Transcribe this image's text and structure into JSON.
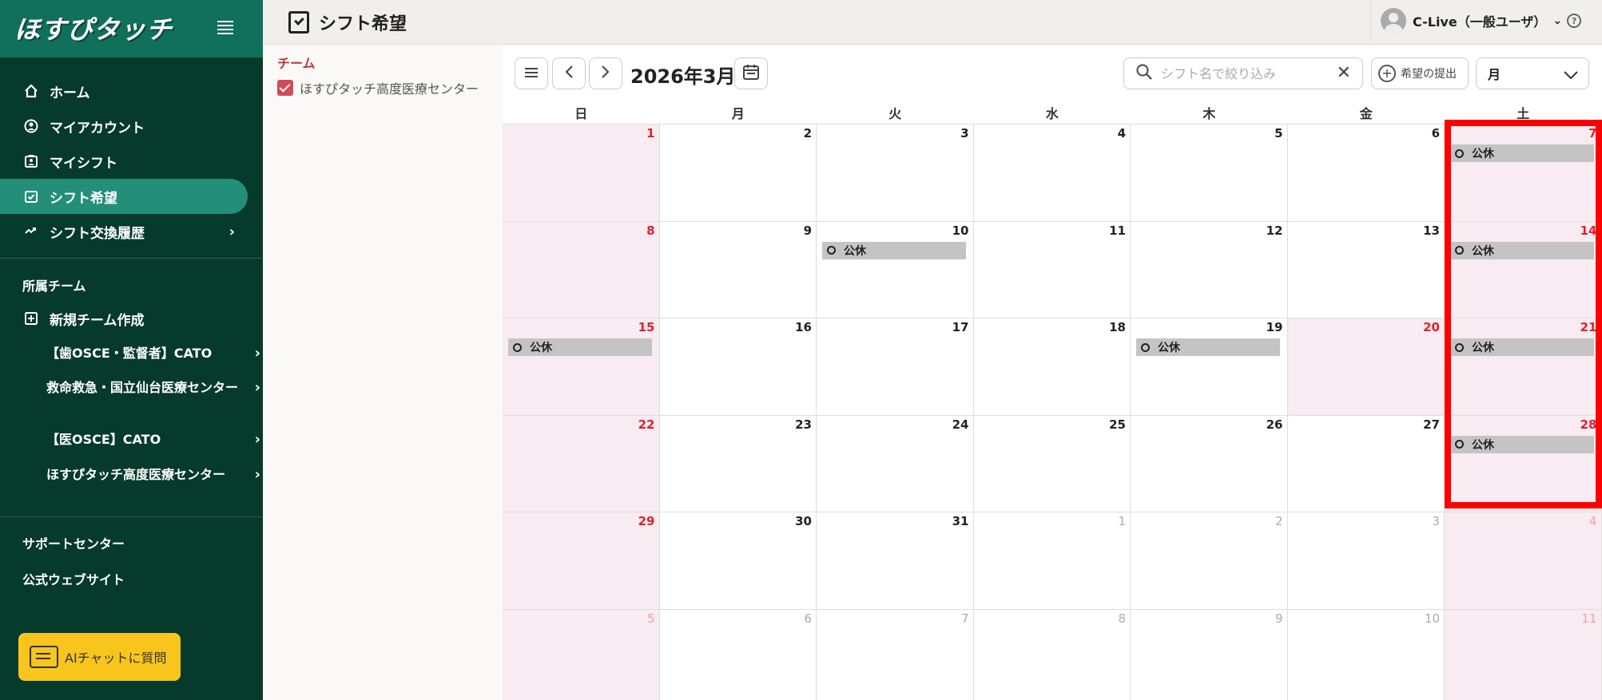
{
  "sidebar": {
    "logo": "ほすぴタッチ",
    "nav": [
      {
        "label": "ホーム",
        "icon": "home-icon"
      },
      {
        "label": "マイアカウント",
        "icon": "user-circle-icon"
      },
      {
        "label": "マイシフト",
        "icon": "badge-icon"
      },
      {
        "label": "シフト希望",
        "icon": "calendar-check-icon"
      },
      {
        "label": "シフト交換履歴",
        "icon": "swap-icon"
      }
    ],
    "team_section_label": "所属チーム",
    "new_team_label": "新規チーム作成",
    "teams": [
      {
        "label": "【歯OSCE・監督者】CATO"
      },
      {
        "label": "救命救急・国立仙台医療センター"
      },
      {
        "label": "【医OSCE】CATO"
      },
      {
        "label": "ほすぴタッチ高度医療センター"
      }
    ],
    "support_label": "サポートセンター",
    "website_label": "公式ウェブサイト",
    "ai_button_label": "AIチャットに質問"
  },
  "header": {
    "title": "シフト希望",
    "user_label": "C-Live（一般ユーザ）",
    "help_symbol": "?"
  },
  "filter": {
    "label": "チーム",
    "checkbox_label": "ほすぴタッチ高度医療センター"
  },
  "calendar": {
    "month_title": "2026年3月",
    "search_placeholder": "シフト名で絞り込み",
    "submit_label": "希望の提出",
    "view_value": "月",
    "dow": [
      "日",
      "月",
      "火",
      "水",
      "木",
      "金",
      "土"
    ],
    "weeks": [
      [
        {
          "n": "1",
          "t": "red"
        },
        {
          "n": "2"
        },
        {
          "n": "3"
        },
        {
          "n": "4"
        },
        {
          "n": "5"
        },
        {
          "n": "6"
        },
        {
          "n": "7",
          "t": "red",
          "e": "公休"
        }
      ],
      [
        {
          "n": "8",
          "t": "red"
        },
        {
          "n": "9"
        },
        {
          "n": "10",
          "e": "公休"
        },
        {
          "n": "11"
        },
        {
          "n": "12"
        },
        {
          "n": "13"
        },
        {
          "n": "14",
          "t": "red",
          "e": "公休"
        }
      ],
      [
        {
          "n": "15",
          "t": "red",
          "e": "公休"
        },
        {
          "n": "16"
        },
        {
          "n": "17"
        },
        {
          "n": "18"
        },
        {
          "n": "19",
          "e": "公休"
        },
        {
          "n": "20",
          "t": "red",
          "pink": true
        },
        {
          "n": "21",
          "t": "red",
          "e": "公休"
        }
      ],
      [
        {
          "n": "22",
          "t": "red"
        },
        {
          "n": "23"
        },
        {
          "n": "24"
        },
        {
          "n": "25"
        },
        {
          "n": "26"
        },
        {
          "n": "27"
        },
        {
          "n": "28",
          "t": "red",
          "e": "公休"
        }
      ],
      [
        {
          "n": "29",
          "t": "red"
        },
        {
          "n": "30"
        },
        {
          "n": "31"
        },
        {
          "n": "1",
          "t": "dim"
        },
        {
          "n": "2",
          "t": "dim"
        },
        {
          "n": "3",
          "t": "dim"
        },
        {
          "n": "4",
          "t": "dimred"
        }
      ],
      [
        {
          "n": "5",
          "t": "dimred"
        },
        {
          "n": "6",
          "t": "dim"
        },
        {
          "n": "7",
          "t": "dim"
        },
        {
          "n": "8",
          "t": "dim"
        },
        {
          "n": "9",
          "t": "dim"
        },
        {
          "n": "10",
          "t": "dim"
        },
        {
          "n": "11",
          "t": "dimred"
        }
      ]
    ]
  }
}
